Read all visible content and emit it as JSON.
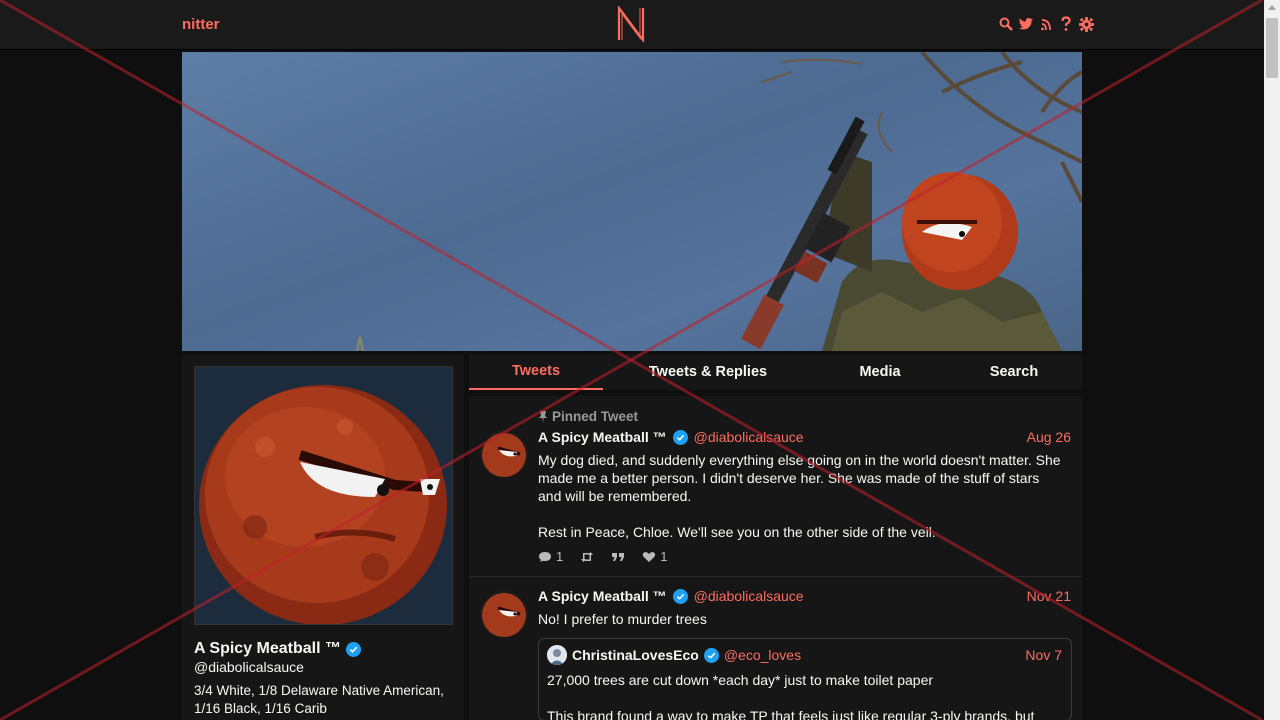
{
  "nav": {
    "logo_text": "nitter",
    "icons": [
      "search-icon",
      "twitter-icon",
      "rss-icon",
      "help-icon",
      "gear-icon"
    ]
  },
  "profile": {
    "name": "A Spicy Meatball ™",
    "handle": "@diabolicalsauce",
    "bio_line1": "3/4 White, 1/8 Delaware Native American,",
    "bio_line2": "1/16 Black, 1/16 Carib"
  },
  "tabs": [
    {
      "label": "Tweets",
      "active": true
    },
    {
      "label": "Tweets & Replies",
      "active": false
    },
    {
      "label": "Media",
      "active": false
    },
    {
      "label": "Search",
      "active": false
    }
  ],
  "tweets": [
    {
      "pinned_label": "Pinned Tweet",
      "name": "A Spicy Meatball ™",
      "handle": "@diabolicalsauce",
      "date": "Aug 26",
      "body_lines": [
        "My dog died, and suddenly everything else going on in the world doesn't matter.  She",
        "made me a better person.  I didn't deserve her.  She was made of the stuff of stars",
        "and will be remembered.",
        "",
        "Rest in Peace, Chloe.  We'll see you on the other side of the veil."
      ],
      "stats": {
        "replies": "1",
        "likes": "1"
      }
    },
    {
      "name": "A Spicy Meatball ™",
      "handle": "@diabolicalsauce",
      "date": "Nov 21",
      "body": "No!  I prefer to murder trees",
      "quote": {
        "name": "ChristinaLovesEco",
        "handle": "@eco_loves",
        "date": "Nov 7",
        "line1": "27,000 trees are cut down *each day* just to make toilet paper",
        "line2": "This brand found a way to make TP that feels just like regular 3-ply brands, but"
      }
    }
  ],
  "colors": {
    "accent": "#ff6c60",
    "background": "#0f0f0f",
    "panel": "#161616",
    "navbar": "#1a1a1a",
    "verified": "#1da1f2"
  }
}
